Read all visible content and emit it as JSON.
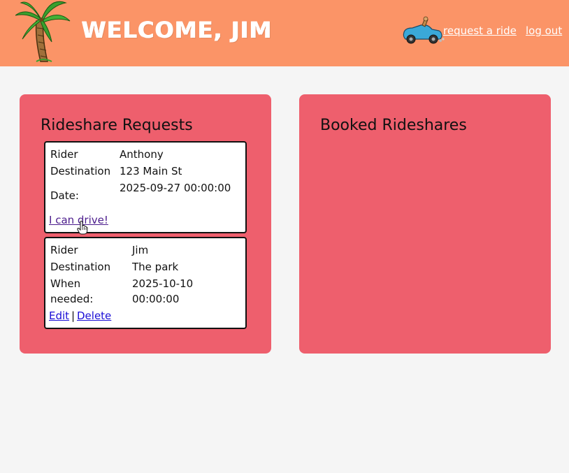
{
  "header": {
    "welcome_text": "WELCOME, JIM",
    "nav": {
      "request_ride": "request a ride",
      "log_out": "log out"
    },
    "colors": {
      "header_bg": "#fb9467",
      "panel_bg": "#ee5f6d"
    },
    "icons": {
      "logo": "palm-tree-icon",
      "car": "car-icon"
    }
  },
  "requests_panel": {
    "title": "Rideshare Requests",
    "cards": [
      {
        "rows": [
          {
            "label": "Rider",
            "value": "Anthony"
          },
          {
            "label": "Destination",
            "value": "123 Main St"
          },
          {
            "label": "Date:",
            "value": "2025-09-27 00:00:00"
          }
        ],
        "action": "I can drive!"
      },
      {
        "rows": [
          {
            "label": "Rider",
            "value": "Jim"
          },
          {
            "label": "Destination",
            "value": "The park"
          },
          {
            "label": "When needed:",
            "value": "2025-10-10 00:00:00"
          }
        ],
        "actions": {
          "edit": "Edit",
          "separator": "|",
          "delete": "Delete"
        }
      }
    ]
  },
  "booked_panel": {
    "title": "Booked Rideshares"
  }
}
